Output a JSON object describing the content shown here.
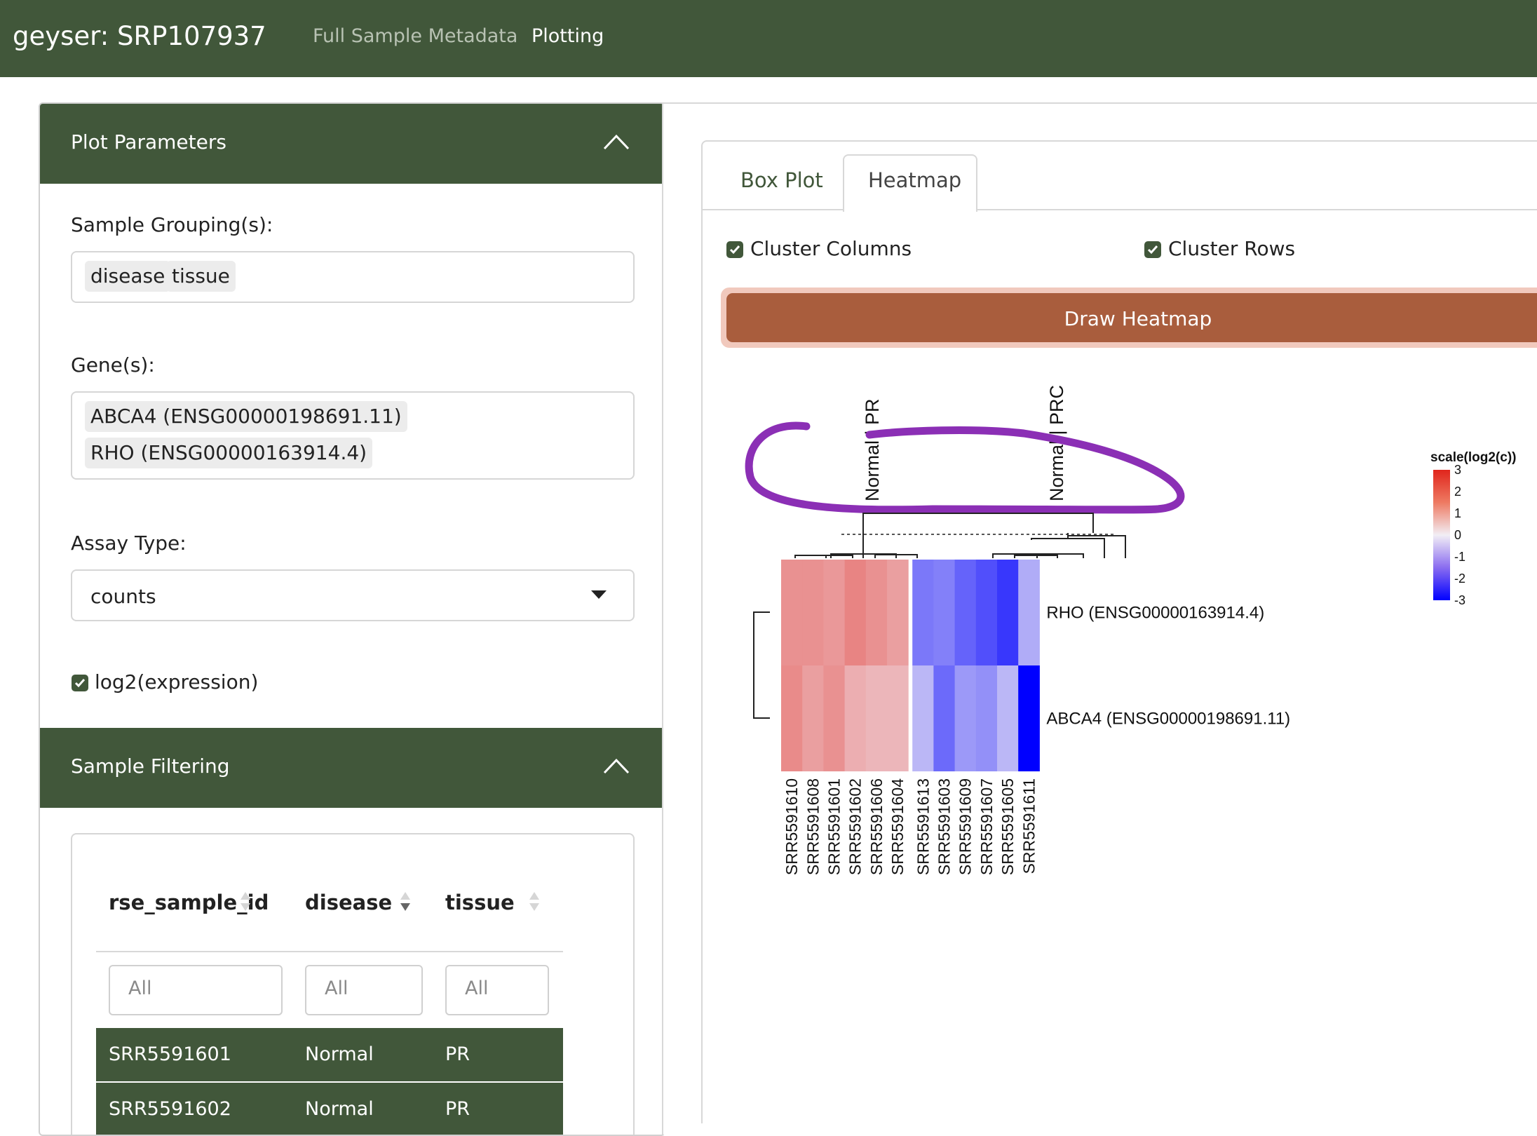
{
  "navbar": {
    "brand": "geyser: SRP107937",
    "links": [
      "Full Sample Metadata",
      "Plotting"
    ]
  },
  "plot_parameters": {
    "title": "Plot Parameters",
    "grouping_label": "Sample Grouping(s):",
    "grouping_values": [
      "disease",
      "tissue"
    ],
    "genes_label": "Gene(s):",
    "genes_values": [
      "ABCA4 (ENSG00000198691.11)",
      "RHO (ENSG00000163914.4)"
    ],
    "assay_label": "Assay Type:",
    "assay_value": "counts",
    "log2_label": "log2(expression)",
    "log2_checked": true
  },
  "sample_filtering": {
    "title": "Sample Filtering",
    "columns": [
      "rse_sample_id",
      "disease",
      "tissue"
    ],
    "filter_placeholder": "All",
    "rows": [
      [
        "SRR5591601",
        "Normal",
        "PR"
      ],
      [
        "SRR5591602",
        "Normal",
        "PR"
      ]
    ]
  },
  "tabs": [
    "Box Plot",
    "Heatmap"
  ],
  "active_tab": "Heatmap",
  "heatmap_options": {
    "cluster_columns_label": "Cluster Columns",
    "cluster_rows_label": "Cluster Rows",
    "draw_button": "Draw Heatmap"
  },
  "colors": {
    "brand_green": "#41573a",
    "button": "#a95d3d",
    "annotation_circle": "#8b2fb5"
  },
  "chart_data": {
    "type": "heatmap",
    "group_labels": [
      "Normal | PR",
      "Normal | PRC"
    ],
    "rows": [
      "RHO (ENSG00000163914.4)",
      "ABCA4 (ENSG00000198691.11)"
    ],
    "columns": [
      "SRR5591610",
      "SRR5591608",
      "SRR5591601",
      "SRR5591602",
      "SRR5591606",
      "SRR5591604",
      "SRR5591613",
      "SRR5591603",
      "SRR5591609",
      "SRR5591607",
      "SRR5591605",
      "SRR5591611"
    ],
    "values": [
      [
        0.9,
        0.9,
        0.8,
        1.1,
        0.9,
        0.7,
        -1.0,
        -0.9,
        -1.3,
        -1.6,
        -2.0,
        -0.4
      ],
      [
        1.0,
        0.7,
        0.9,
        0.5,
        0.4,
        0.4,
        -0.3,
        -1.2,
        -0.6,
        -0.7,
        -0.3,
        -3.0
      ]
    ],
    "legend_title": "scale(log2(c))",
    "legend_ticks": [
      3,
      2,
      1,
      0,
      -1,
      -2,
      -3
    ],
    "scale_range": [
      -3,
      3
    ]
  }
}
